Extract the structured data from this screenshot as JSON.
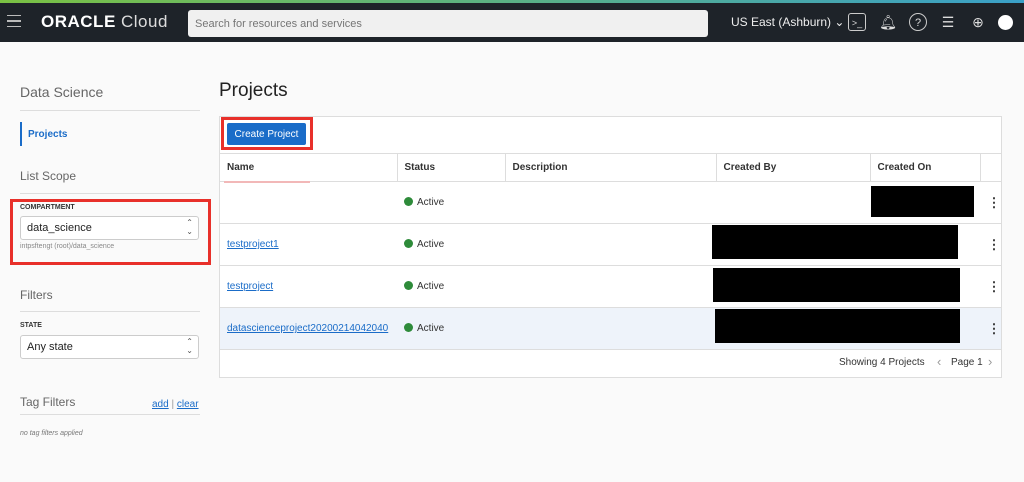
{
  "header": {
    "logo_bold": "ORACLE",
    "logo_light": " Cloud",
    "search_placeholder": "Search for resources and services",
    "region": "US East (Ashburn)",
    "icons": [
      "cloud-shell-icon",
      "bell-icon",
      "help-icon",
      "chat-icon",
      "globe-icon",
      "user-icon"
    ]
  },
  "sidebar": {
    "title": "Data Science",
    "nav": [
      {
        "label": "Projects",
        "active": true
      }
    ],
    "list_scope": "List Scope",
    "compartment_label": "COMPARTMENT",
    "compartment_value": "data_science",
    "compartment_path": "intpsftengt (root)/data_science",
    "filters": "Filters",
    "state_label": "STATE",
    "state_value": "Any state",
    "tag_filters": "Tag Filters",
    "add": "add",
    "sep": "|",
    "clear": "clear",
    "no_tags": "no tag filters applied"
  },
  "main": {
    "title": "Projects",
    "create_button": "Create Project",
    "columns": [
      "Name",
      "Status",
      "Description",
      "Created By",
      "Created On"
    ],
    "rows": [
      {
        "name": "",
        "status": "Active"
      },
      {
        "name": "testproject1",
        "status": "Active"
      },
      {
        "name": "testproject",
        "status": "Active"
      },
      {
        "name": "datascienceproject20200214042040",
        "status": "Active"
      }
    ],
    "showing": "Showing 4 Projects",
    "page": "Page 1"
  },
  "colors": {
    "accent": "#1a6cc8",
    "active": "#2e8b3a",
    "highlight": "#e8302a"
  }
}
